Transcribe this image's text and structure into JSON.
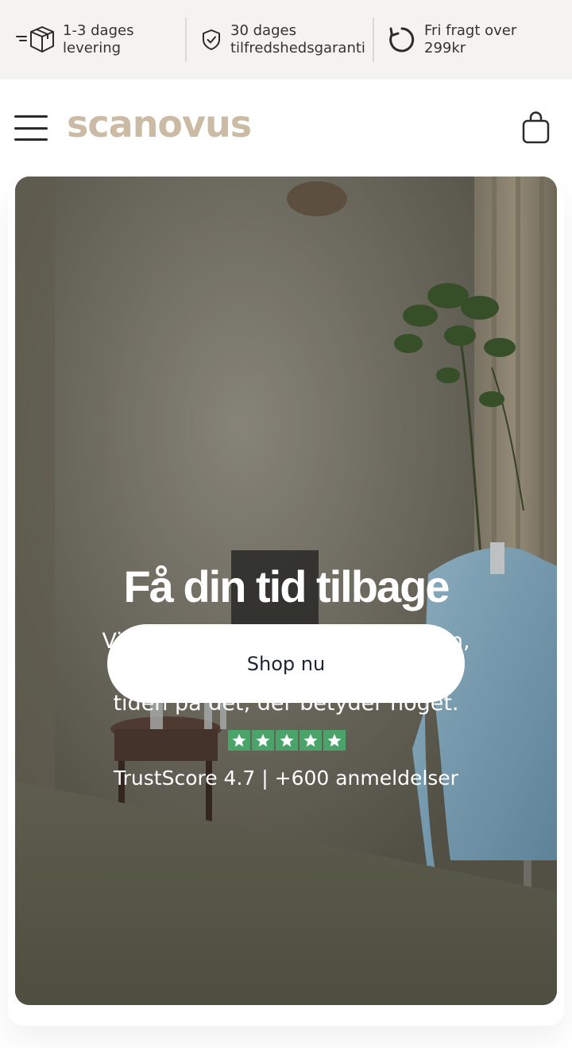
{
  "usp": [
    {
      "icon": "package-icon",
      "line1": "1-3 dages",
      "line2": "levering"
    },
    {
      "icon": "shield-check-icon",
      "line1": "30 dages",
      "line2": "tilfredshedsgaranti"
    },
    {
      "icon": "refresh-icon",
      "line1": "Fri fragt over",
      "line2": "299kr"
    }
  ],
  "header": {
    "logo": "scanovus",
    "menu_icon": "hamburger-menu-icon",
    "cart_icon": "shopping-bag-icon"
  },
  "hero": {
    "title": "Få din tid tilbage",
    "subtitle": "Vi fjerner de opgaver i hverdagen, du udskyder – så du kan bruge tiden på det, der betyder noget.",
    "cta": "Shop nu",
    "rating_stars": 5,
    "trust_text": "TrustScore 4.7 | +600 anmeldelser"
  },
  "colors": {
    "usp_bg": "#f5f3f0",
    "logo": "#cbbba5",
    "star_green": "#4aa46a",
    "cta_text": "#1c2433"
  }
}
